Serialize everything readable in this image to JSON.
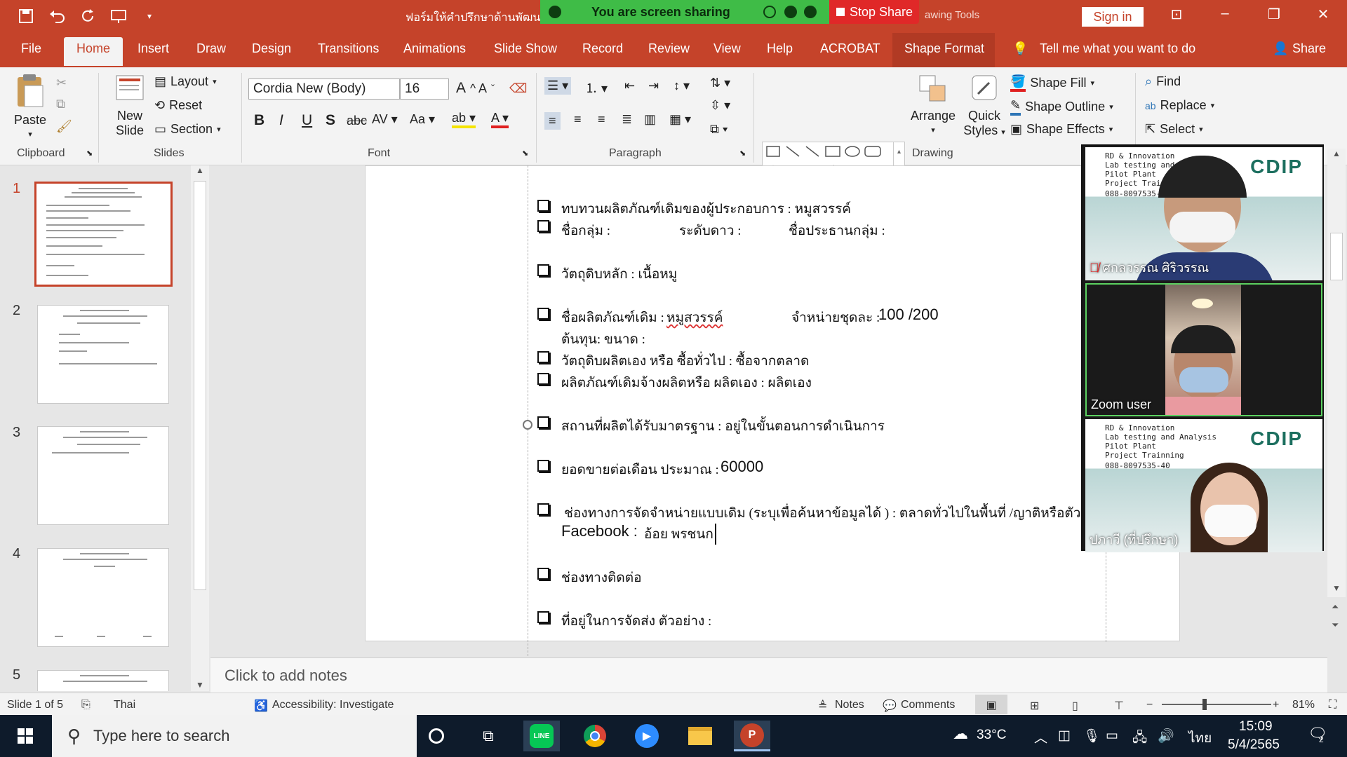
{
  "titlebar": {
    "doc_title": "ฟอร์มให้คำปรึกษาด้านพัฒนา",
    "context_title": "awing Tools",
    "share_banner": "You are screen sharing",
    "stop_share": "Stop Share",
    "sign_in": "Sign in"
  },
  "tabs": [
    "File",
    "Home",
    "Insert",
    "Draw",
    "Design",
    "Transitions",
    "Animations",
    "Slide Show",
    "Record",
    "Review",
    "View",
    "Help",
    "ACROBAT",
    "Shape Format"
  ],
  "tell_me": "Tell me what you want to do",
  "share": "Share",
  "ribbon": {
    "clipboard": {
      "paste": "Paste",
      "label": "Clipboard"
    },
    "slides": {
      "new_slide_1": "New",
      "new_slide_2": "Slide",
      "layout": "Layout",
      "reset": "Reset",
      "section": "Section",
      "label": "Slides"
    },
    "font": {
      "family": "Cordia New (Body)",
      "size": "16",
      "label": "Font"
    },
    "paragraph": {
      "label": "Paragraph"
    },
    "drawing": {
      "arrange": "Arrange",
      "quick_styles_1": "Quick",
      "quick_styles_2": "Styles",
      "shape_fill": "Shape Fill",
      "shape_outline": "Shape Outline",
      "shape_effects": "Shape Effects",
      "label": "Drawing"
    },
    "editing": {
      "find": "Find",
      "replace": "Replace",
      "select": "Select"
    }
  },
  "thumbnails": [
    "1",
    "2",
    "3",
    "4",
    "5"
  ],
  "slide": {
    "items": [
      "ทบทวนผลิตภัณฑ์เดิมของผู้ประกอบการ : หมูสวรรค์",
      "ชื่อกลุ่ม :",
      "ระดับดาว :",
      "ชื่อประธานกลุ่ม :",
      "วัตถุดิบหลัก  : เนื้อหมู",
      "ชื่อผลิตภัณฑ์เดิม :",
      "หมูสวรรค์",
      "จำหน่ายชุดละ :",
      "100 /200",
      "ต้นทุน:     ขนาด :",
      "วัตถุดิบผลิตเอง หรือ ซื้อทั่วไป : ซื้อจากตลาด",
      "ผลิตภัณฑ์เดิมจ้างผลิตหรือ ผลิตเอง : ผลิตเอง",
      "สถานที่ผลิตได้รับมาตรฐาน :  อยู่ในขั้นตอนการดำเนินการ",
      "ยอดขายต่อเดือน ประมาณ   :",
      "60000",
      "ช่องทางการจัดจำหน่ายแบบเดิม (ระบุเพื่อค้นหาข้อมูลได้ )  :  ตลาดทั่วไปในพื้นที่ /ญาติหรือตัวแทน",
      "Facebook :",
      "อ้อย พรชนก",
      "ช่องทางติดต่อ",
      "ที่อยู่ในการจัดส่ง ตัวอย่าง :"
    ]
  },
  "notes": "Click to add notes",
  "status": {
    "slide_of": "Slide 1 of 5",
    "language": "Thai",
    "accessibility": "Accessibility: Investigate",
    "notes": "Notes",
    "comments": "Comments",
    "zoom": "81%"
  },
  "video": {
    "p1": "ศกลวรรณ ศิริวรรณ",
    "p2": "Zoom user",
    "p3": "ปภาวี (ที่ปรึกษา)",
    "banner_lines": [
      "RD & Innovation",
      "Lab testing and Analysis",
      "Pilot Plant",
      "Project Trainning",
      "088-8097535-40"
    ],
    "banner_lines_short": [
      "RD & Innovation",
      "Lab testing and Analy",
      "Pilot Plant",
      "Project Trainin",
      "088-8097535-"
    ],
    "logo": "CDIP"
  },
  "taskbar": {
    "search_placeholder": "Type here to search",
    "weather": "33°C",
    "lang": "ไทย",
    "time": "15:09",
    "date": "5/4/2565",
    "notif_count": "2"
  }
}
